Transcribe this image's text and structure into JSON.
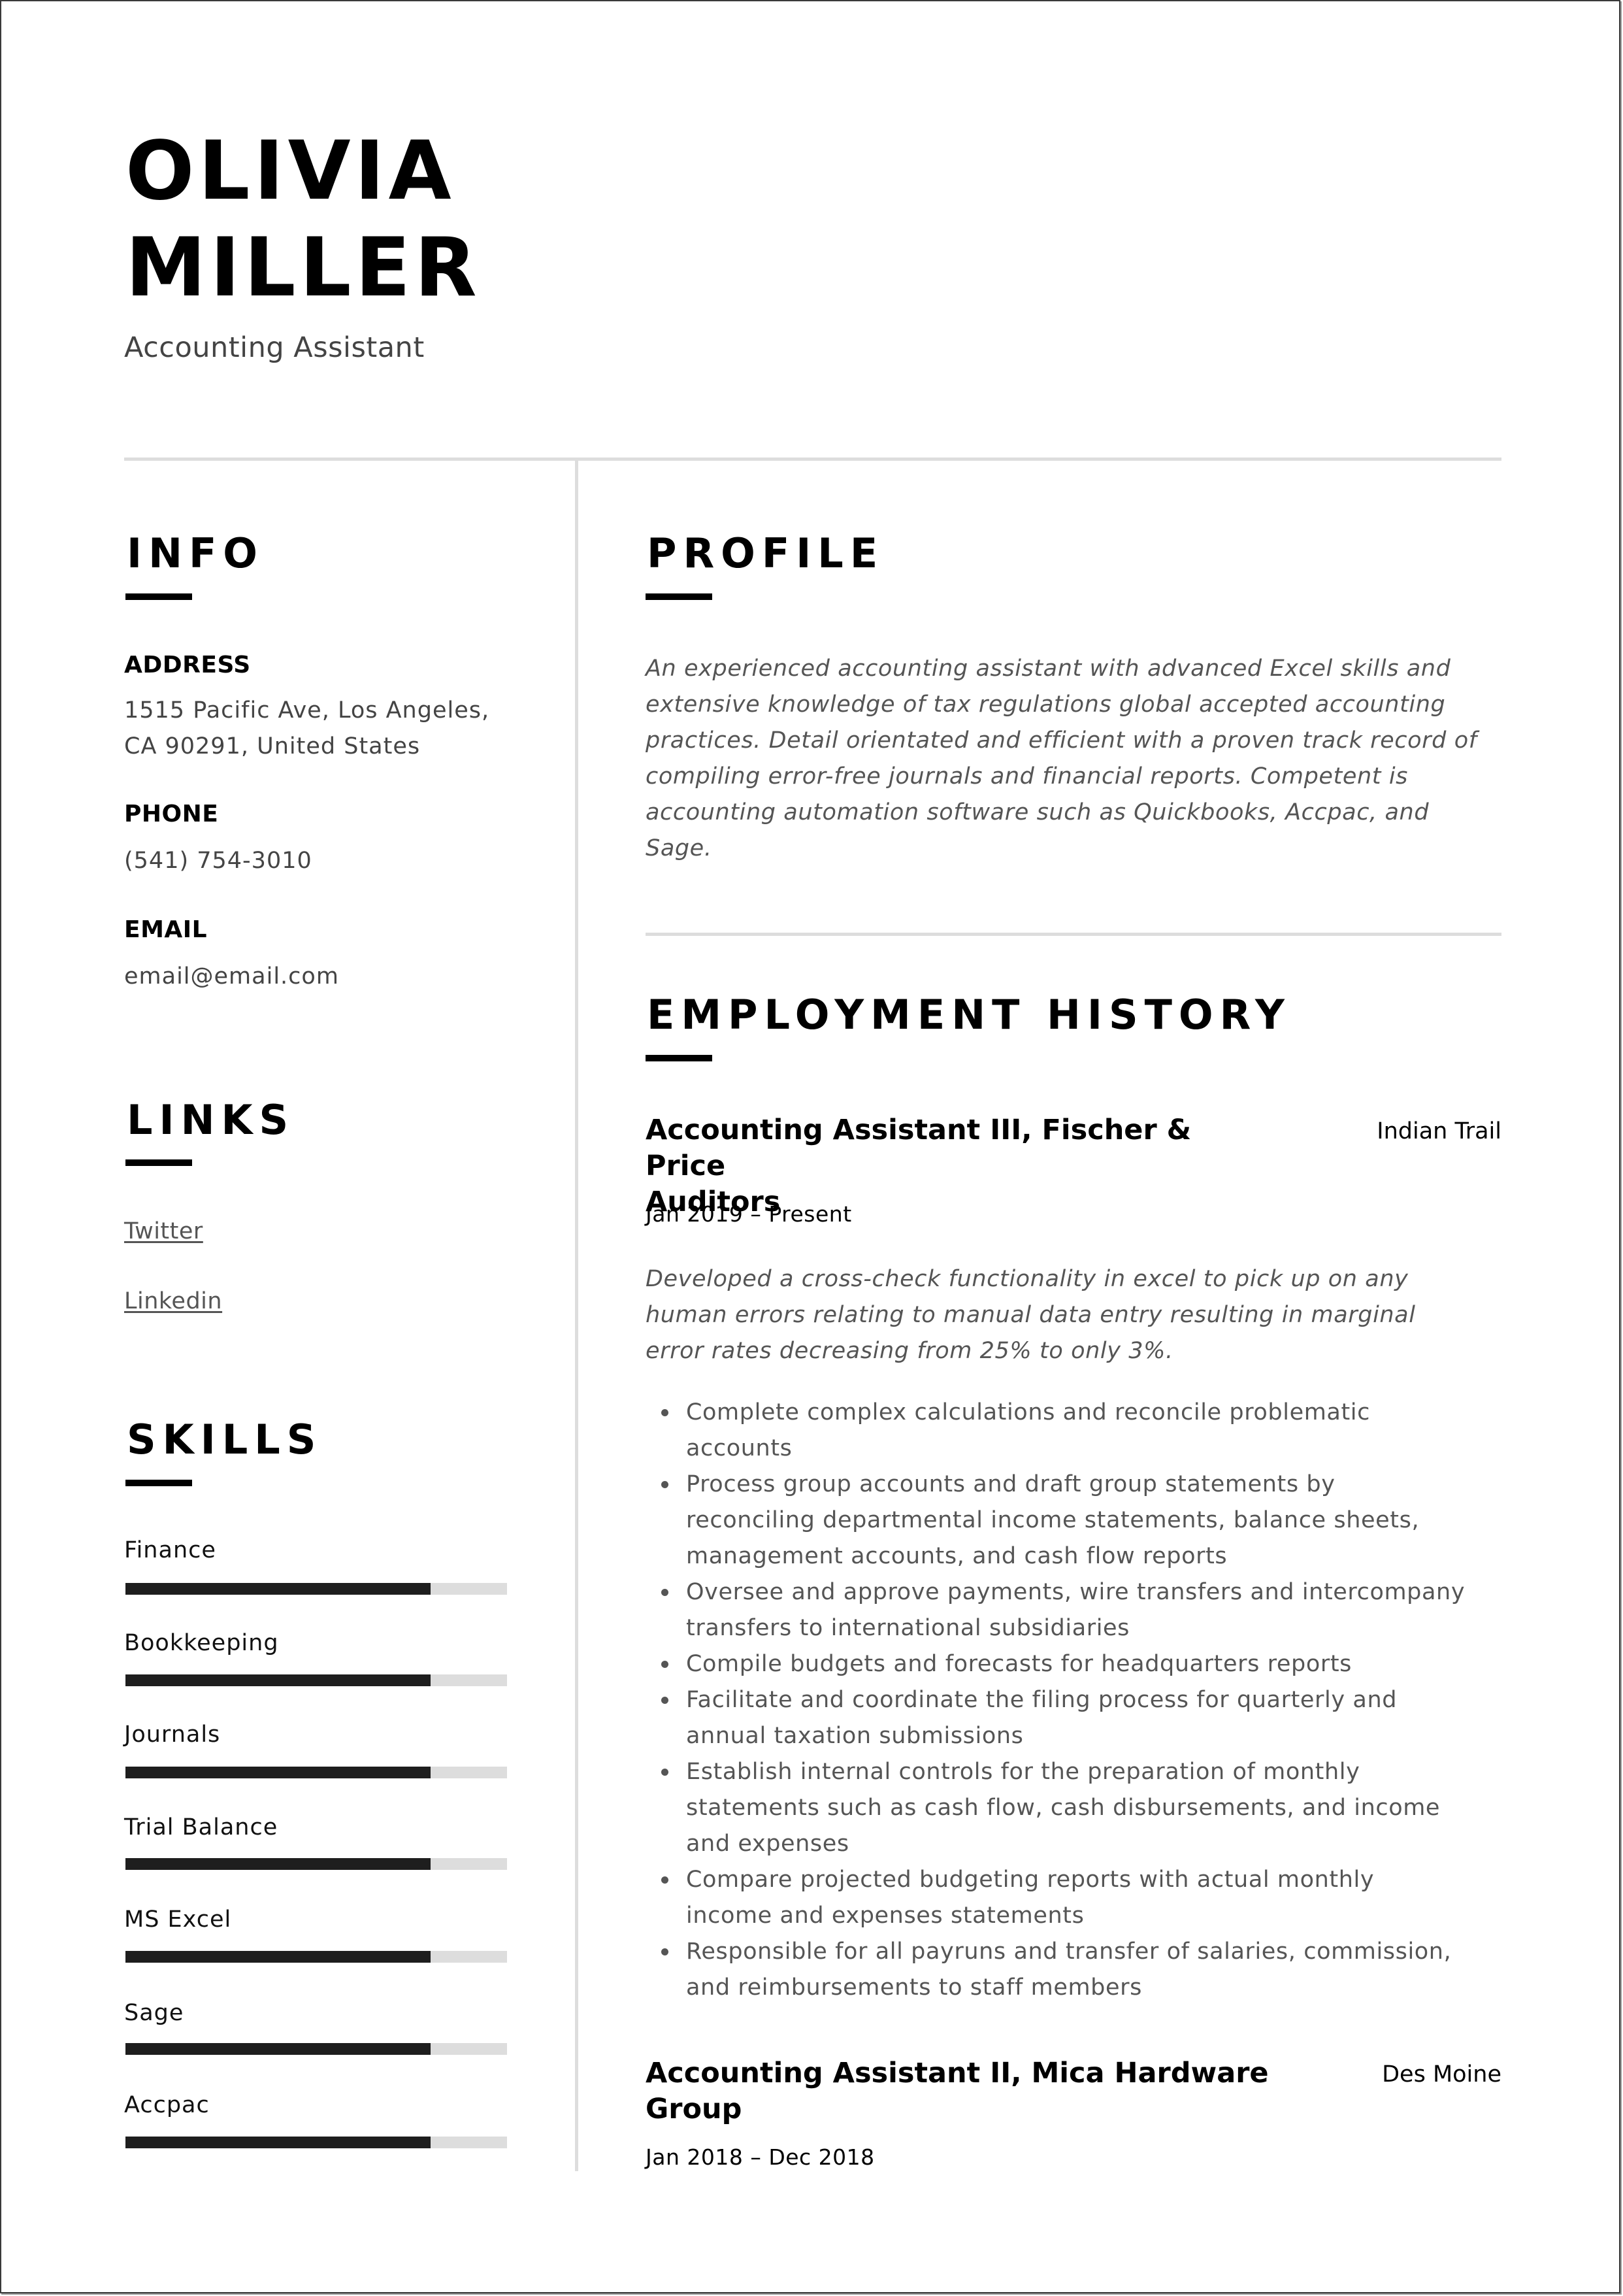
{
  "header": {
    "first_name": "OLIVIA",
    "last_name": "MILLER",
    "job_title": "Accounting Assistant"
  },
  "left": {
    "info": {
      "title": "INFO",
      "address_label": "ADDRESS",
      "address_line1": "1515 Pacific Ave, Los Angeles,",
      "address_line2": "CA 90291, United States",
      "phone_label": "PHONE",
      "phone": "(541) 754-3010",
      "email_label": "EMAIL",
      "email": "email@email.com"
    },
    "links": {
      "title": "LINKS",
      "items": [
        {
          "label": "Twitter"
        },
        {
          "label": "Linkedin"
        }
      ]
    },
    "skills": {
      "title": "SKILLS",
      "items": [
        {
          "label": "Finance",
          "level": 0.8
        },
        {
          "label": "Bookkeeping",
          "level": 0.8
        },
        {
          "label": "Journals",
          "level": 0.8
        },
        {
          "label": "Trial Balance",
          "level": 0.8
        },
        {
          "label": "MS Excel",
          "level": 0.8
        },
        {
          "label": "Sage",
          "level": 0.8
        },
        {
          "label": "Accpac",
          "level": 0.8
        }
      ]
    }
  },
  "right": {
    "profile": {
      "title": "PROFILE",
      "lines": [
        "An experienced accounting assistant with advanced Excel skills and",
        "extensive knowledge of tax regulations global accepted accounting",
        "practices. Detail orientated and efficient with a proven track record of",
        "compiling error-free journals and financial reports. Competent is",
        "accounting automation software such as Quickbooks, Accpac, and",
        "Sage."
      ]
    },
    "employment": {
      "title": "EMPLOYMENT HISTORY",
      "jobs": [
        {
          "title_line1": "Accounting Assistant III, Fischer & Price",
          "title_line2": "Auditors",
          "location": "Indian Trail",
          "dates": "Jan 2019 – Present",
          "summary_lines": [
            "Developed a cross-check functionality in excel to pick up on any",
            "human errors relating to manual data entry resulting in marginal",
            "error rates decreasing from 25% to only 3%."
          ],
          "bullets": [
            [
              "Complete complex calculations and reconcile problematic",
              "accounts"
            ],
            [
              "Process group accounts and draft group statements by",
              "reconciling departmental income statements, balance sheets,",
              "management accounts, and cash flow reports"
            ],
            [
              "Oversee and approve payments, wire transfers and intercompany",
              "transfers to international subsidiaries"
            ],
            [
              "Compile budgets and forecasts for headquarters reports"
            ],
            [
              "Facilitate and coordinate the filing process for quarterly and",
              "annual taxation submissions"
            ],
            [
              "Establish internal controls for the preparation of monthly",
              "statements such as cash flow, cash disbursements, and income",
              "and expenses"
            ],
            [
              "Compare projected budgeting reports with actual monthly",
              "income and expenses statements"
            ],
            [
              "Responsible for all payruns and transfer of salaries, commission,",
              "and reimbursements to staff members"
            ]
          ]
        },
        {
          "title_line1": "Accounting Assistant II, Mica Hardware",
          "title_line2": "Group",
          "location": "Des Moine",
          "dates": "Jan 2018 – Dec 2018"
        }
      ]
    }
  },
  "colors": {
    "text_primary": "#000000",
    "text_secondary": "#444444",
    "divider": "#dddddd",
    "skill_fill": "#1e1e1e",
    "skill_track": "#dddddd"
  }
}
